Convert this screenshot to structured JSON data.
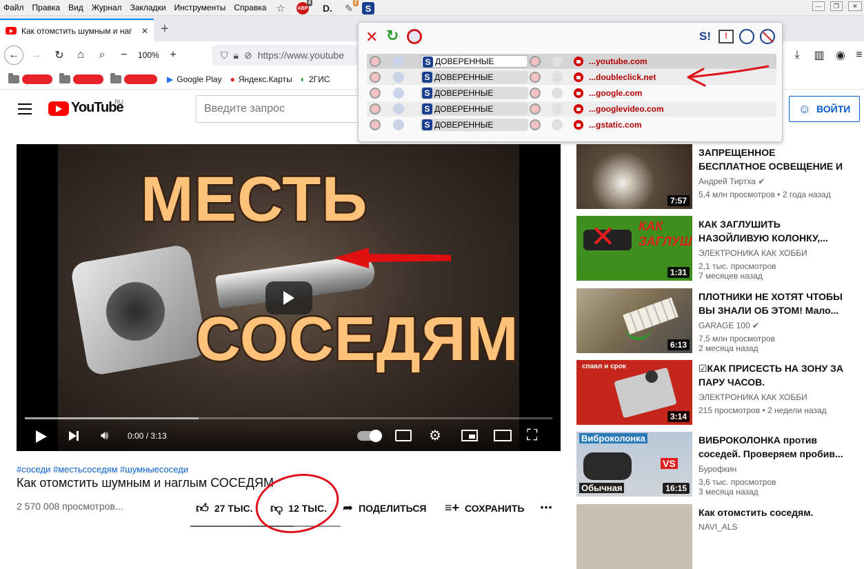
{
  "menubar": {
    "items": [
      "Файл",
      "Правка",
      "Вид",
      "Журнал",
      "Закладки",
      "Инструменты",
      "Справка"
    ],
    "ext_badges": {
      "abp_label": "ABP",
      "abp_count": "4",
      "ext2_count": "2",
      "d_label": "D.",
      "s_label": "S"
    }
  },
  "tab": {
    "title": "Как отомстить шумным и наг",
    "new_tab": "+",
    "close": "✕"
  },
  "nav": {
    "zoom": "100%",
    "zoom_minus": "−",
    "zoom_plus": "+",
    "url": "https://www.youtube"
  },
  "bookmarks": [
    "Google Play",
    "Яндекс.Карты",
    "2ГИС"
  ],
  "youtube": {
    "logo": "YouTube",
    "logo_region": "RU",
    "search_placeholder": "Введите запрос",
    "signin": "ВОЙТИ"
  },
  "video": {
    "overlay_top": "МЕСТЬ",
    "overlay_bottom": "СОСЕДЯМ",
    "time": "0:00 / 3:13",
    "progress": 0.33,
    "hashtags": "#соседи #местьсоседям #шумныесоседи",
    "title": "Как отомстить шумным и наглым СОСЕДЯМ",
    "views": "2 570 008 просмотров...",
    "likes": "27 ТЫС.",
    "dislikes": "12 ТЫС.",
    "share": "ПОДЕЛИТЬСЯ",
    "save": "СОХРАНИТЬ",
    "more": "⋯"
  },
  "related": [
    {
      "title": "ЗАПРЕЩЕННОЕ БЕСПЛАТНОЕ ОСВЕЩЕНИЕ И ОТОПЛЕНИЕ,...",
      "channel": "Андрей Тиртха",
      "verified": true,
      "views": "5,4 млн просмотров",
      "age": "2 года назад",
      "duration": "7:57",
      "thumb_color": "#5a4a3a"
    },
    {
      "title": "КАК ЗАГЛУШИТЬ НАЗОЙЛИВУЮ КОЛОНКУ,...",
      "channel": "ЭЛЕКТРОНИКА КАК ХОББИ",
      "verified": false,
      "views": "2,1 тыс. просмотров",
      "age": "7 месяцев назад",
      "duration": "1:31",
      "thumb_color": "#3e8f1e",
      "thumb_text": "КАК ЗАГЛУШИТЬ"
    },
    {
      "title": "ПЛОТНИКИ НЕ ХОТЯТ ЧТОБЫ ВЫ ЗНАЛИ ОБ ЭТОМ! Мало...",
      "channel": "GARAGE 100",
      "verified": true,
      "views": "7,5 млн просмотров",
      "age": "2 месяца назад",
      "duration": "6:13",
      "thumb_color": "#8a7a60"
    },
    {
      "title": "☑КАК ПРИСЕСТЬ НА ЗОНУ ЗА ПАРУ ЧАСОВ.",
      "channel": "ЭЛЕКТРОНИКА КАК ХОББИ",
      "verified": false,
      "views": "215 просмотров",
      "age": "2 недели назад",
      "duration": "3:14",
      "thumb_color": "#c4261c",
      "thumb_text": "спаял и срок"
    },
    {
      "title": "ВИБРОКОЛОНКА против соседей. Проверяем пробив...",
      "channel": "Бурофкин",
      "verified": false,
      "views": "3,6 тыс. просмотров",
      "age": "3 месяца назад",
      "duration": "16:15",
      "thumb_color": "#a8b8c8",
      "thumb_text": "Виброколонка",
      "thumb_text2": "Обычная",
      "thumb_vs": "VS"
    },
    {
      "title": "Как отомстить соседям.",
      "channel": "NAVI_ALS",
      "verified": false,
      "views": "",
      "age": "",
      "duration": "",
      "thumb_color": "#c9c0b2"
    }
  ],
  "popup": {
    "rows": [
      {
        "trust": "ДОВЕРЕННЫЕ",
        "domain": "...youtube.com"
      },
      {
        "trust": "ДОВЕРЕННЫЕ",
        "domain": "...doubleclick.net"
      },
      {
        "trust": "ДОВЕРЕННЫЕ",
        "domain": "...google.com"
      },
      {
        "trust": "ДОВЕРЕННЫЕ",
        "domain": "...googlevideo.com"
      },
      {
        "trust": "ДОВЕРЕННЫЕ",
        "domain": "...gstatic.com"
      }
    ],
    "header_s_label": "S!"
  },
  "colors": {
    "youtube_red": "#ff0000",
    "link_blue": "#065fd4",
    "annotation_red": "#e0101a",
    "popup_domain": "#b20000"
  }
}
